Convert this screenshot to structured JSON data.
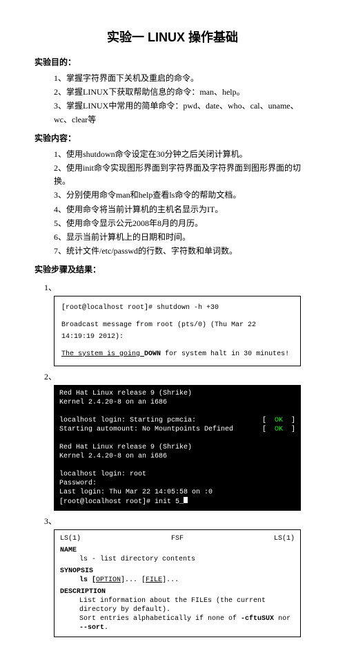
{
  "title": "实验一 LINUX 操作基础",
  "sections": {
    "purpose": {
      "heading": "实验目的：",
      "items": [
        "1、掌握字符界面下关机及重启的命令。",
        "2、掌握LINUX下获取帮助信息的命令：man、help。",
        "3、掌握LINUX中常用的简单命令：pwd、date、who、cal、uname、wc、clear等"
      ]
    },
    "content": {
      "heading": "实验内容：",
      "items": [
        "1、使用shutdown命令设定在30分钟之后关闭计算机。",
        "2、使用init命令实现图形界面到字符界面及字符界面到图形界面的切换。",
        "3、分别使用命令man和help查看ls命令的帮助文档。",
        "4、使用命令将当前计算机的主机名显示为IT。",
        "5、使用命令显示公元2008年8月的月历。",
        "6、显示当前计算机上的日期和时间。",
        "7、统计文件/etc/passwd的行数、字符数和单词数。"
      ]
    },
    "steps_heading": "实验步骤及结果：",
    "step1": {
      "num": "1、",
      "l1": "[root@localhost root]# shutdown -h +30",
      "l2": "Broadcast message from root (pts/0) (Thu Mar 22 14:19:19 2012):",
      "l3a": "The system is going ",
      "l3b": "DOWN",
      "l3c": " for system halt in 30 minutes!"
    },
    "step2": {
      "num": "2、",
      "l1": "Red Hat Linux release 9 (Shrike)",
      "l2": "Kernel 2.4.20-8 on an i686",
      "l3a": "localhost login: Starting pcmcia:",
      "l3b": "[  ",
      "l3ok": "OK",
      "l3c": "  ]",
      "l4a": "Starting automount: No Mountpoints Defined",
      "l4b": "[  ",
      "l4ok": "OK",
      "l4c": "  ]",
      "l5": "Red Hat Linux release 9 (Shrike)",
      "l6": "Kernel 2.4.20-8 on an i686",
      "l7": "localhost login: root",
      "l8": "Password:",
      "l9": "Last login: Thu Mar 22 14:05:58 on :0",
      "l10": "[root@localhost root]# init 5_"
    },
    "step3": {
      "num": "3、",
      "hdr_l": "LS(1)",
      "hdr_c": "FSF",
      "hdr_r": "LS(1)",
      "name_h": "NAME",
      "name_t": "ls - list directory contents",
      "syn_h": "SYNOPSIS",
      "syn_a": "ls [",
      "syn_b": "OPTION",
      "syn_c": "]... [",
      "syn_d": "FILE",
      "syn_e": "]...",
      "desc_h": "DESCRIPTION",
      "desc_t1": "List  information  about  the FILEs (the current directory by default).",
      "desc_t2a": "Sort entries alphabetically if none of ",
      "desc_t2b": "-cftuSUX",
      "desc_t2c": " nor ",
      "desc_t2d": "--sort",
      "desc_t2e": "."
    }
  }
}
